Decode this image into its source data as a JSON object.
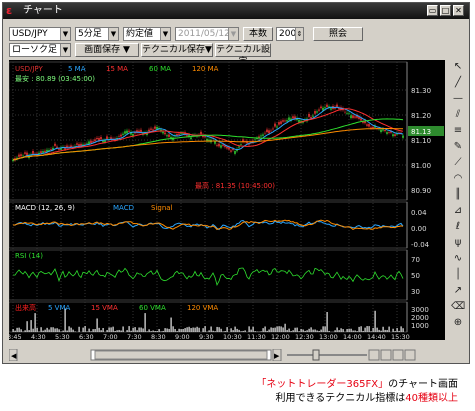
{
  "window": {
    "title": "チャート"
  },
  "toolbar": {
    "pair": "USD/JPY",
    "interval": "5分足",
    "price_type": "約定値",
    "date": "2011/05/12",
    "count_label": "本数",
    "count_value": "200",
    "search_btn": "照会",
    "chart_type": "ローソク足",
    "save_screen_btn": "画面保存",
    "save_tech_btn": "テクニカル保存",
    "tech_settings_btn": "テクニカル設定"
  },
  "main_panel": {
    "legend": [
      {
        "label": "USD/JPY",
        "color": "#e03030"
      },
      {
        "label": "5 MA",
        "color": "#2aa6ff"
      },
      {
        "label": "15 MA",
        "color": "#ff3030"
      },
      {
        "label": "60 MA",
        "color": "#2ee02e"
      },
      {
        "label": "120 MA",
        "color": "#ff8c00"
      }
    ],
    "high_label": "最安 : 80.89 (03:45:00)",
    "low_label": "最高 : 81.35 (10:45:00)",
    "y_ticks": [
      "81.30",
      "81.20",
      "81.10",
      "81.00",
      "80.90"
    ],
    "current_price": "81.13"
  },
  "macd_panel": {
    "legend": [
      {
        "label": "MACD (12, 26, 9)",
        "color": "#ffffff"
      },
      {
        "label": "MACD",
        "color": "#2aa6ff"
      },
      {
        "label": "Signal",
        "color": "#ff8c00"
      }
    ],
    "y_ticks": [
      "0.04",
      "0.00",
      "-0.04"
    ]
  },
  "rsi_panel": {
    "legend": [
      {
        "label": "RSI (14)",
        "color": "#2ee02e"
      }
    ],
    "y_ticks": [
      "70",
      "50",
      "30"
    ]
  },
  "volume_panel": {
    "legend": [
      {
        "label": "出来高",
        "color": "#ff2020"
      },
      {
        "label": "5 VMA",
        "color": "#2aa6ff"
      },
      {
        "label": "15 VMA",
        "color": "#ff3030"
      },
      {
        "label": "60 VMA",
        "color": "#2ee02e"
      },
      {
        "label": "120 VMA",
        "color": "#ff8c00"
      }
    ],
    "y_ticks": [
      "3000",
      "2000",
      "1000"
    ]
  },
  "x_ticks": [
    "3:45",
    "4:30",
    "5:30",
    "6:30",
    "7:00",
    "7:30",
    "8:30",
    "9:00",
    "9:30",
    "10:30",
    "11:30",
    "12:00",
    "12:30",
    "13:00",
    "14:00",
    "14:40",
    "15:30"
  ],
  "caption": {
    "line1_red": "「ネットトレーダー365FX」",
    "line1_black": "のチャート画面",
    "line2_black": "利用できるテクニカル指標は",
    "line2_red": "40種類以上"
  }
}
